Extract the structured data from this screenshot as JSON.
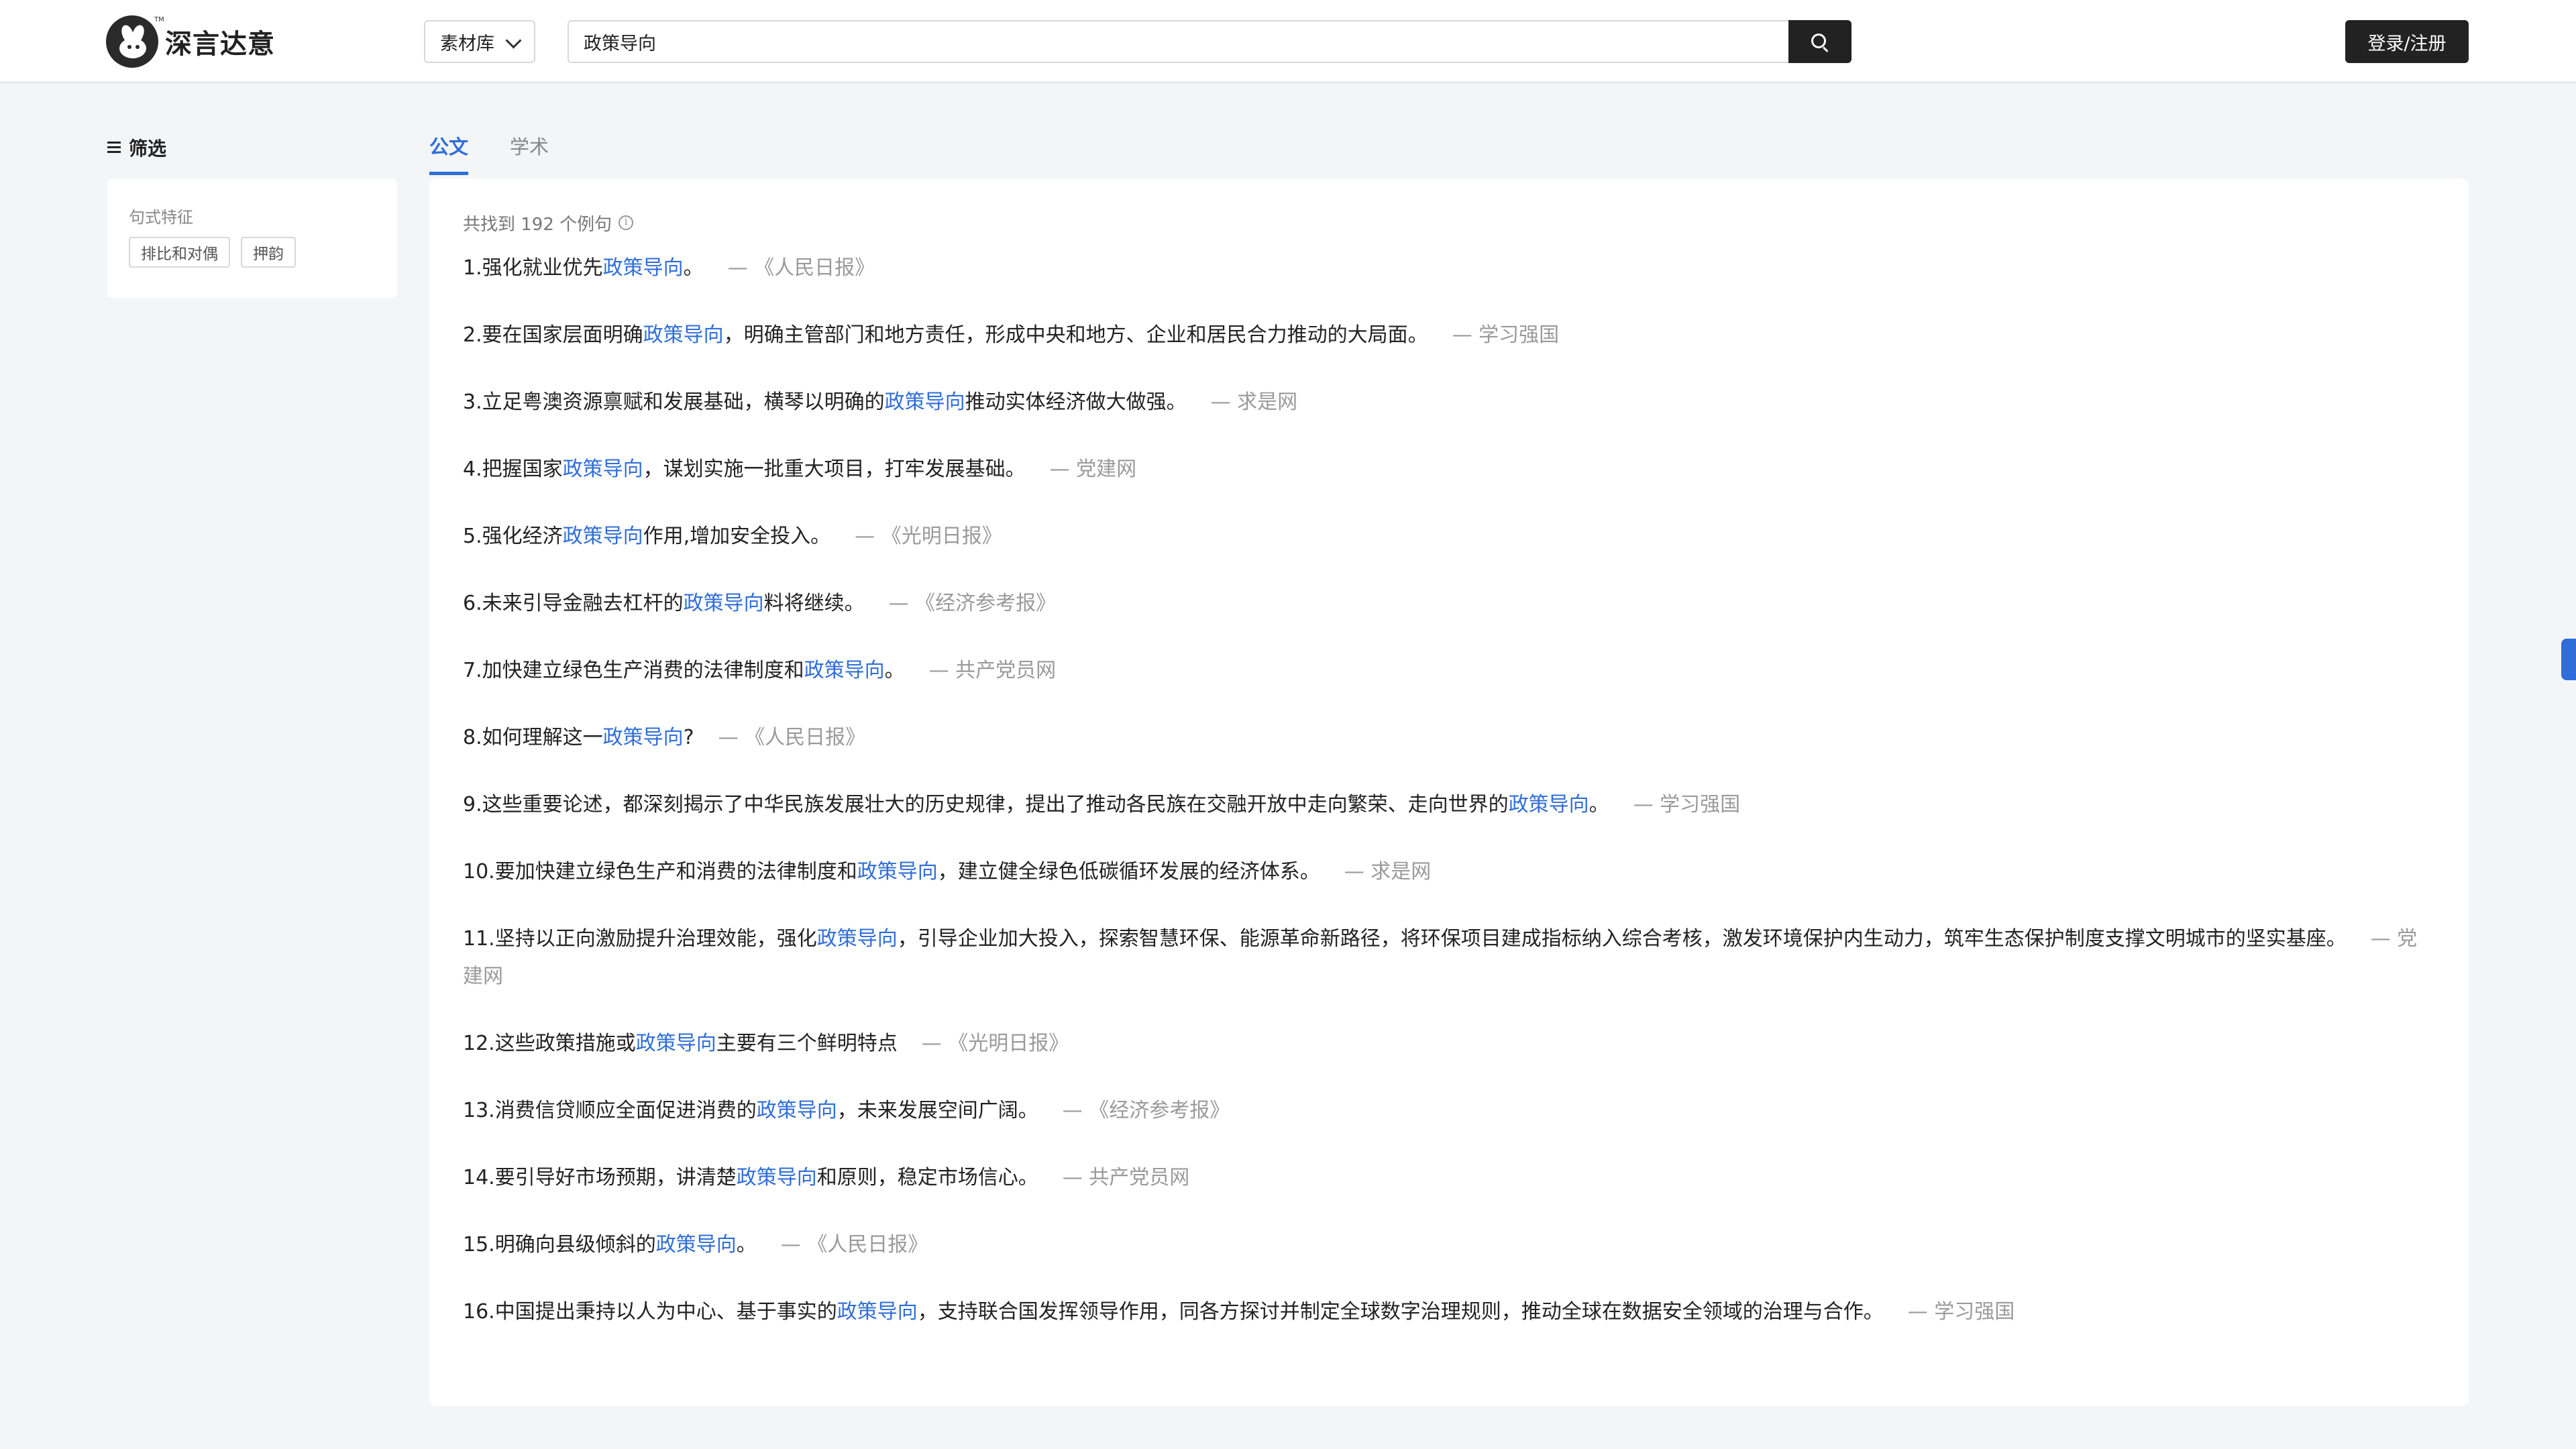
{
  "header": {
    "logo_text": "深言达意",
    "logo_tm": "TM",
    "category_select": "素材库",
    "search_value": "政策导向",
    "login_label": "登录/注册"
  },
  "sidebar": {
    "filter_title": "筛选",
    "group_label": "句式特征",
    "tags": [
      "排比和对偶",
      "押韵"
    ]
  },
  "tabs": [
    {
      "label": "公文",
      "active": true
    },
    {
      "label": "学术",
      "active": false
    }
  ],
  "results": {
    "count_text": "共找到 192 个例句",
    "items": [
      {
        "num": "1.",
        "pre": "强化就业优先",
        "hl": "政策导向",
        "post": "。",
        "src": "— 《人民日报》"
      },
      {
        "num": "2.",
        "pre": "要在国家层面明确",
        "hl": "政策导向",
        "post": "，明确主管部门和地方责任，形成中央和地方、企业和居民合力推动的大局面。",
        "src": "— 学习强国"
      },
      {
        "num": "3.",
        "pre": "立足粤澳资源禀赋和发展基础，横琴以明确的",
        "hl": "政策导向",
        "post": "推动实体经济做大做强。",
        "src": "— 求是网"
      },
      {
        "num": "4.",
        "pre": "把握国家",
        "hl": "政策导向",
        "post": "，谋划实施一批重大项目，打牢发展基础。",
        "src": "— 党建网"
      },
      {
        "num": "5.",
        "pre": "强化经济",
        "hl": "政策导向",
        "post": "作用,增加安全投入。",
        "src": "— 《光明日报》"
      },
      {
        "num": "6.",
        "pre": "未来引导金融去杠杆的",
        "hl": "政策导向",
        "post": "料将继续。",
        "src": "— 《经济参考报》"
      },
      {
        "num": "7.",
        "pre": "加快建立绿色生产消费的法律制度和",
        "hl": "政策导向",
        "post": "。",
        "src": "— 共产党员网"
      },
      {
        "num": "8.",
        "pre": "如何理解这一",
        "hl": "政策导向",
        "post": "?",
        "src": "— 《人民日报》"
      },
      {
        "num": "9.",
        "pre": "这些重要论述，都深刻揭示了中华民族发展壮大的历史规律，提出了推动各民族在交融开放中走向繁荣、走向世界的",
        "hl": "政策导向",
        "post": "。",
        "src": "— 学习强国"
      },
      {
        "num": "10.",
        "pre": "要加快建立绿色生产和消费的法律制度和",
        "hl": "政策导向",
        "post": "，建立健全绿色低碳循环发展的经济体系。",
        "src": "— 求是网"
      },
      {
        "num": "11.",
        "pre": "坚持以正向激励提升治理效能，强化",
        "hl": "政策导向",
        "post": "，引导企业加大投入，探索智慧环保、能源革命新路径，将环保项目建成指标纳入综合考核，激发环境保护内生动力，筑牢生态保护制度支撑文明城市的坚实基座。",
        "src": "— 党建网"
      },
      {
        "num": "12.",
        "pre": "这些政策措施或",
        "hl": "政策导向",
        "post": "主要有三个鲜明特点",
        "src": "— 《光明日报》"
      },
      {
        "num": "13.",
        "pre": "消费信贷顺应全面促进消费的",
        "hl": "政策导向",
        "post": "，未来发展空间广阔。",
        "src": "— 《经济参考报》"
      },
      {
        "num": "14.",
        "pre": "要引导好市场预期，讲清楚",
        "hl": "政策导向",
        "post": "和原则，稳定市场信心。",
        "src": "— 共产党员网"
      },
      {
        "num": "15.",
        "pre": "明确向县级倾斜的",
        "hl": "政策导向",
        "post": "。",
        "src": "— 《人民日报》"
      },
      {
        "num": "16.",
        "pre": "中国提出秉持以人为中心、基于事实的",
        "hl": "政策导向",
        "post": "，支持联合国发挥领导作用，同各方探讨并制定全球数字治理规则，推动全球在数据安全领域的治理与合作。",
        "src": "— 学习强国"
      }
    ]
  },
  "colors": {
    "accent": "#2f6ed8",
    "dark": "#222222",
    "muted": "#9a9a9a"
  },
  "icons": [
    "logo-icon",
    "chevron-down-icon",
    "search-icon",
    "menu-icon",
    "info-icon"
  ]
}
